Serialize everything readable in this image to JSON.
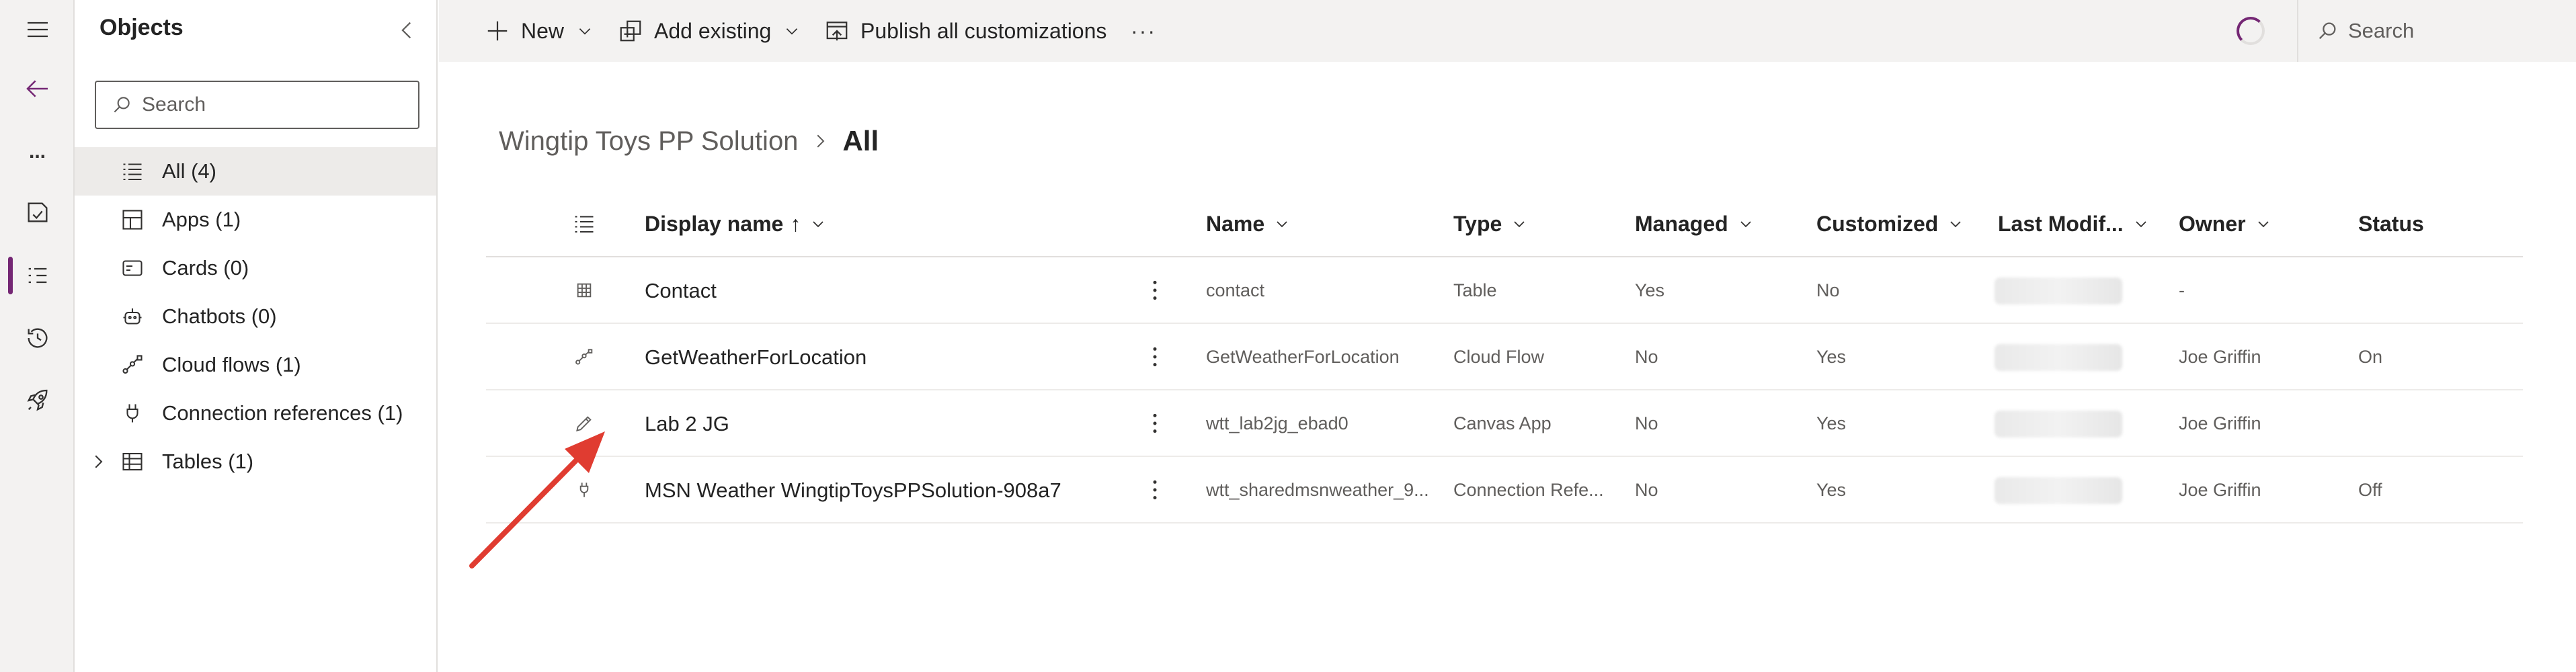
{
  "rail": {
    "items": [
      {
        "name": "hamburger-menu-icon"
      },
      {
        "name": "back-arrow-icon"
      },
      {
        "name": "more-ellipsis-icon",
        "label": "..."
      },
      {
        "name": "overview-icon"
      },
      {
        "name": "objects-icon",
        "active": true
      },
      {
        "name": "history-icon"
      },
      {
        "name": "pipelines-rocket-icon"
      }
    ],
    "accent_color": "#742774"
  },
  "objects_pane": {
    "title": "Objects",
    "search_placeholder": "Search",
    "items": [
      {
        "label": "All  (4)",
        "icon": "list-icon",
        "selected": true
      },
      {
        "label": "Apps  (1)",
        "icon": "apps-icon"
      },
      {
        "label": "Cards  (0)",
        "icon": "card-icon"
      },
      {
        "label": "Chatbots  (0)",
        "icon": "chatbot-icon"
      },
      {
        "label": "Cloud flows  (1)",
        "icon": "flow-icon"
      },
      {
        "label": "Connection references  (1)",
        "icon": "plug-icon"
      },
      {
        "label": "Tables  (1)",
        "icon": "table-icon",
        "expandable": true
      }
    ]
  },
  "command_bar": {
    "new_label": "New",
    "add_existing_label": "Add existing",
    "publish_label": "Publish all customizations",
    "more_label": "···",
    "search_placeholder": "Search"
  },
  "breadcrumb": {
    "parent": "Wingtip Toys PP Solution",
    "current": "All"
  },
  "grid": {
    "columns": {
      "display_name": "Display name",
      "name": "Name",
      "type": "Type",
      "managed": "Managed",
      "customized": "Customized",
      "last_modified": "Last Modif...",
      "owner": "Owner",
      "status": "Status"
    },
    "sort_indicator": "↑",
    "rows": [
      {
        "icon": "table-grid-icon",
        "display_name": "Contact",
        "name": "contact",
        "type": "Table",
        "managed": "Yes",
        "customized": "No",
        "owner": "-",
        "status": ""
      },
      {
        "icon": "cloud-flow-icon",
        "display_name": "GetWeatherForLocation",
        "name": "GetWeatherForLocation",
        "type": "Cloud Flow",
        "managed": "No",
        "customized": "Yes",
        "owner": "Joe Griffin",
        "status": "On"
      },
      {
        "icon": "canvas-app-pencil-icon",
        "display_name": "Lab 2 JG",
        "name": "wtt_lab2jg_ebad0",
        "type": "Canvas App",
        "managed": "No",
        "customized": "Yes",
        "owner": "Joe Griffin",
        "status": ""
      },
      {
        "icon": "connection-plug-icon",
        "display_name": "MSN Weather WingtipToysPPSolution-908a7",
        "name": "wtt_sharedmsnweather_9...",
        "type": "Connection Refe...",
        "managed": "No",
        "customized": "Yes",
        "owner": "Joe Griffin",
        "status": "Off"
      }
    ]
  },
  "annotation": {
    "color": "#e03c31"
  }
}
